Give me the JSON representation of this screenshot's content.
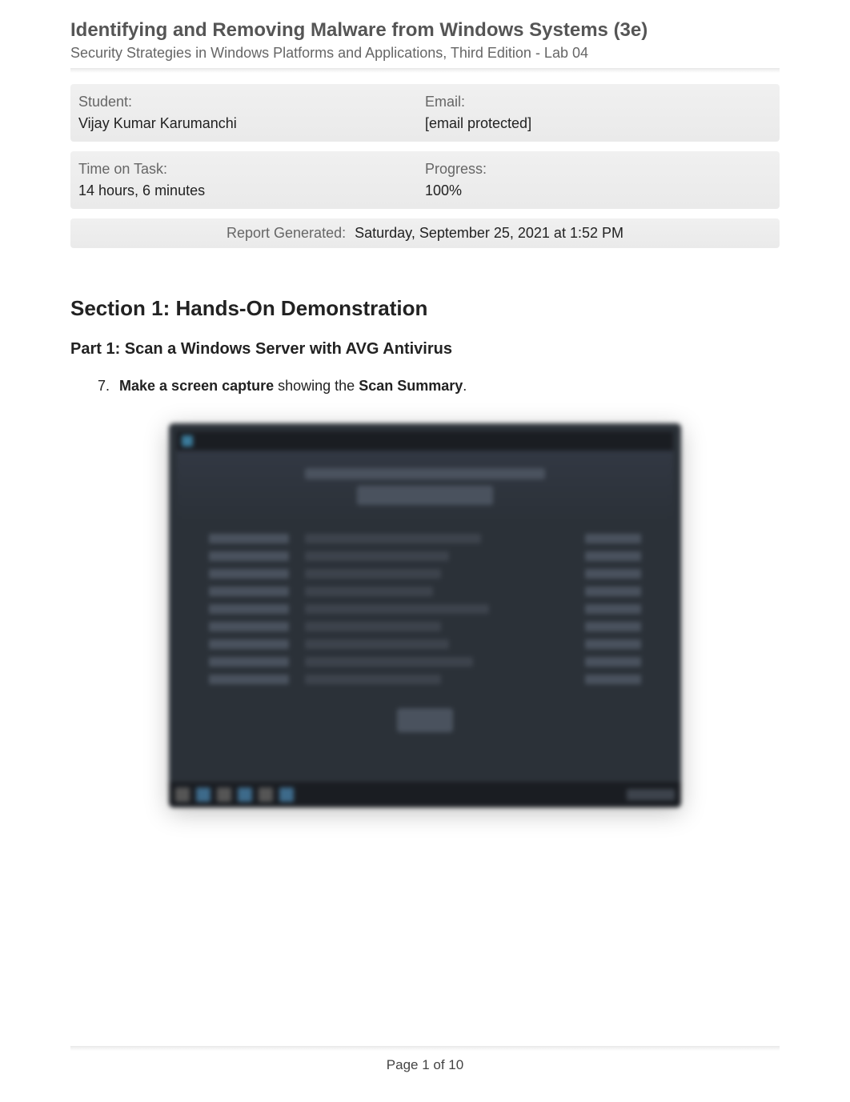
{
  "header": {
    "title": "Identifying and Removing Malware from Windows Systems (3e)",
    "subtitle": "Security Strategies in Windows Platforms and Applications, Third Edition - Lab 04"
  },
  "info": {
    "student_label": "Student:",
    "student_value": "Vijay Kumar Karumanchi",
    "email_label": "Email:",
    "email_value": "[email protected]",
    "time_label": "Time on Task:",
    "time_value": "14 hours, 6 minutes",
    "progress_label": "Progress:",
    "progress_value": "100%"
  },
  "report": {
    "label": "Report Generated:",
    "value": "Saturday, September 25, 2021 at 1:52 PM"
  },
  "section": {
    "heading": "Section 1: Hands-On Demonstration",
    "part_heading": "Part 1: Scan a Windows Server with AVG Antivirus",
    "step_number": "7.",
    "step_bold1": "Make a screen capture",
    "step_mid": " showing the ",
    "step_bold2": "Scan Summary",
    "step_end": "."
  },
  "footer": {
    "page_text": "Page 1 of 10"
  }
}
